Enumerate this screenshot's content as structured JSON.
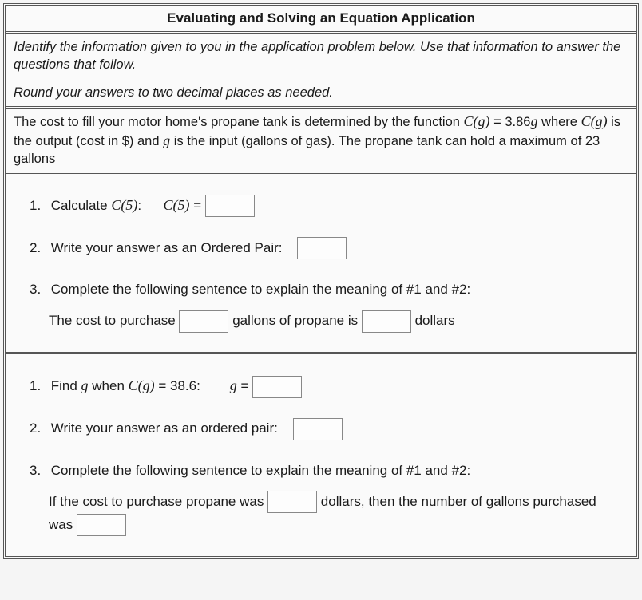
{
  "header": {
    "title": "Evaluating and Solving an Equation Application"
  },
  "instructions": {
    "main": "Identify the information given to you in the application problem below. Use that information to answer the questions that follow.",
    "round": "Round your answers to two decimal places as needed."
  },
  "problem": {
    "line_pre": "The cost to fill your motor home's propane tank is determined by the function ",
    "func_lhs": "C(g)",
    "func_eq": " = 3.86",
    "func_var": "g",
    "func_mid": " where ",
    "func_lhs2": "C(g)",
    "func_post": " is the output (cost in $) and ",
    "func_var2": "g",
    "func_tail": " is the input (gallons of gas). The propane tank can hold a maximum of 23 gallons"
  },
  "section_a": {
    "q1_num": "1.",
    "q1_text": "Calculate ",
    "q1_math": "C(5)",
    "q1_colon": ":",
    "q1_label_math": "C(5)",
    "q1_label_eq": " = ",
    "q2_num": "2.",
    "q2_text": "Write your answer as an Ordered Pair:",
    "q3_num": "3.",
    "q3_text": "Complete the following sentence to explain the meaning of #1 and #2:",
    "q3_fill_pre": "The cost to purchase ",
    "q3_fill_mid": " gallons of propane is ",
    "q3_fill_post": " dollars"
  },
  "section_b": {
    "q1_num": "1.",
    "q1_text_pre": "Find ",
    "q1_var": "g",
    "q1_text_mid": " when ",
    "q1_math": "C(g)",
    "q1_eq": " = 38.6:",
    "q1_label_var": "g",
    "q1_label_eq": " = ",
    "q2_num": "2.",
    "q2_text": "Write your answer as an ordered pair:",
    "q3_num": "3.",
    "q3_text": "Complete the following sentence to explain the meaning of #1 and #2:",
    "q3_fill_pre": "If the cost to purchase propane was ",
    "q3_fill_mid": " dollars, then the number of gallons purchased was "
  }
}
